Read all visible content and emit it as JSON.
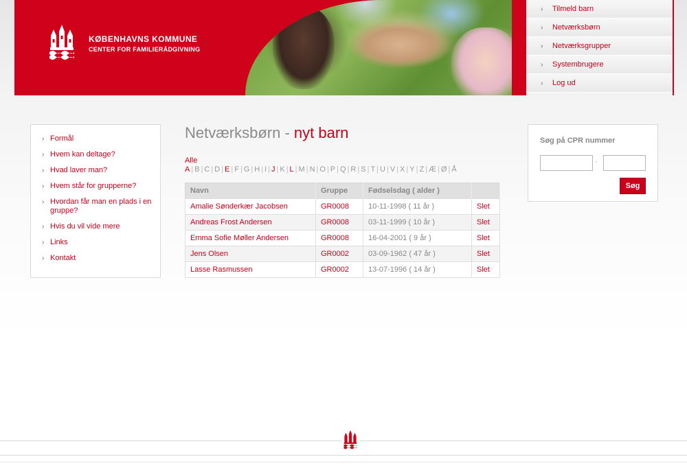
{
  "brand": {
    "title": "KØBENHAVNS KOMMUNE",
    "subtitle": "CENTER FOR FAMILIERÅDGIVNING",
    "color": "#d0021b",
    "logo_icon": "copenhagen-coat-of-arms-icon"
  },
  "top_nav": [
    {
      "label": "Tilmeld barn"
    },
    {
      "label": "Netværksbørn"
    },
    {
      "label": "Netværksgrupper"
    },
    {
      "label": "Systembrugere"
    },
    {
      "label": "Log ud"
    }
  ],
  "left_nav": [
    {
      "label": "Formål"
    },
    {
      "label": "Hvem kan deltage?"
    },
    {
      "label": "Hvad laver man?"
    },
    {
      "label": "Hvem står for grupperne?"
    },
    {
      "label": "Hvordan får man en plads i en gruppe?"
    },
    {
      "label": "Hvis du vil vide mere"
    },
    {
      "label": "Links"
    },
    {
      "label": "Kontakt"
    }
  ],
  "page": {
    "title_main": "Netværksbørn",
    "title_sep": " - ",
    "title_accent": "nyt barn"
  },
  "alphabet": {
    "all_label": "Alle",
    "letters": [
      {
        "l": "A",
        "active": true
      },
      {
        "l": "B",
        "active": false
      },
      {
        "l": "C",
        "active": false
      },
      {
        "l": "D",
        "active": false
      },
      {
        "l": "E",
        "active": true
      },
      {
        "l": "F",
        "active": false
      },
      {
        "l": "G",
        "active": false
      },
      {
        "l": "H",
        "active": false
      },
      {
        "l": "I",
        "active": false
      },
      {
        "l": "J",
        "active": true
      },
      {
        "l": "K",
        "active": false
      },
      {
        "l": "L",
        "active": true
      },
      {
        "l": "M",
        "active": false
      },
      {
        "l": "N",
        "active": false
      },
      {
        "l": "O",
        "active": false
      },
      {
        "l": "P",
        "active": false
      },
      {
        "l": "Q",
        "active": false
      },
      {
        "l": "R",
        "active": false
      },
      {
        "l": "S",
        "active": false
      },
      {
        "l": "T",
        "active": false
      },
      {
        "l": "U",
        "active": false
      },
      {
        "l": "V",
        "active": false
      },
      {
        "l": "X",
        "active": false
      },
      {
        "l": "Y",
        "active": false
      },
      {
        "l": "Z",
        "active": false
      },
      {
        "l": "Æ",
        "active": false
      },
      {
        "l": "Ø",
        "active": false
      },
      {
        "l": "Å",
        "active": false
      }
    ]
  },
  "table": {
    "headers": [
      "Navn",
      "Gruppe",
      "Fødselsdag ( alder )",
      ""
    ],
    "rows": [
      {
        "name": "Amalie Sønderkær Jacobsen",
        "group": "GR0008",
        "birthday": "10-11-1998 ( 11 år )",
        "delete": "Slet"
      },
      {
        "name": "Andreas Frost Andersen",
        "group": "GR0008",
        "birthday": "03-11-1999 ( 10 år )",
        "delete": "Slet"
      },
      {
        "name": "Emma Sofie Møller Andersen",
        "group": "GR0008",
        "birthday": "16-04-2001 ( 9 år )",
        "delete": "Slet"
      },
      {
        "name": "Jens Olsen",
        "group": "GR0002",
        "birthday": "03-09-1962 ( 47 år )",
        "delete": "Slet"
      },
      {
        "name": "Lasse Rasmussen",
        "group": "GR0002",
        "birthday": "13-07-1996 ( 14 år )",
        "delete": "Slet"
      }
    ]
  },
  "search": {
    "title": "Søg på CPR nummer",
    "field1_value": "",
    "field2_value": "",
    "separator": "-",
    "button_label": "Søg"
  }
}
